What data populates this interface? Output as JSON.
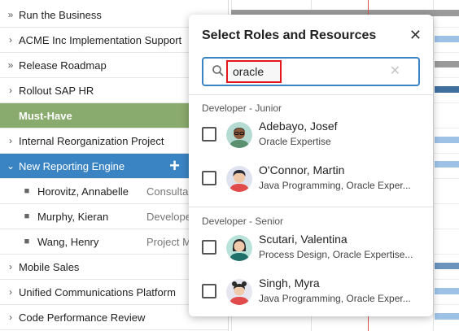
{
  "tree": {
    "rows": [
      {
        "chevron": "»",
        "label": "Run the Business"
      },
      {
        "chevron": "›",
        "label": "ACME Inc Implementation Support"
      },
      {
        "chevron": "»",
        "label": "Release Roadmap"
      },
      {
        "chevron": "›",
        "label": "Rollout SAP HR"
      },
      {
        "chevron": "",
        "label": "Must-Have"
      },
      {
        "chevron": "›",
        "label": "Internal Reorganization Project"
      },
      {
        "chevron": "⌄",
        "label": "New Reporting Engine",
        "action": "+"
      },
      {
        "name": "Horovitz, Annabelle",
        "role": "Consultant -"
      },
      {
        "name": "Murphy, Kieran",
        "role": "Developer -"
      },
      {
        "name": "Wang, Henry",
        "role": "Project Man"
      },
      {
        "chevron": "›",
        "label": "Mobile Sales"
      },
      {
        "chevron": "›",
        "label": "Unified Communications Platform"
      },
      {
        "chevron": "›",
        "label": "Code Performance Review"
      }
    ]
  },
  "dialog": {
    "title": "Select Roles and Resources",
    "search": {
      "value": "oracle",
      "placeholder": ""
    },
    "groups": [
      {
        "title": "Developer - Junior",
        "items": [
          {
            "name": "Adebayo, Josef",
            "skills": "Oracle Expertise",
            "checked": false
          },
          {
            "name": "O'Connor, Martin",
            "skills": "Java Programming, Oracle Exper...",
            "checked": false
          }
        ]
      },
      {
        "title": "Developer - Senior",
        "items": [
          {
            "name": "Scutari, Valentina",
            "skills": "Process Design, Oracle Expertise...",
            "checked": false
          },
          {
            "name": "Singh, Myra",
            "skills": "Java Programming, Oracle Exper...",
            "checked": false
          }
        ]
      }
    ]
  },
  "colors": {
    "accent": "#3a84c4",
    "must_have": "#8aab6e",
    "highlight": "#e5191d",
    "today_line": "#d9534f"
  }
}
